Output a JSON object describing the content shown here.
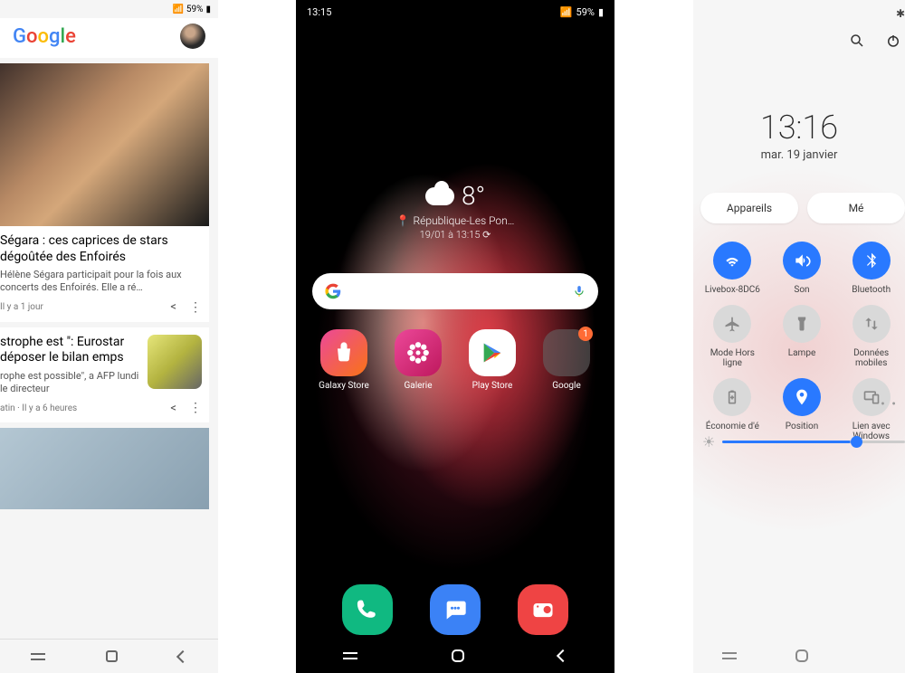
{
  "discover": {
    "status": {
      "battery": "59%"
    },
    "logo": [
      "G",
      "o",
      "o",
      "g",
      "l",
      "e"
    ],
    "card1": {
      "title": "Ségara : ces caprices de stars dégoûtée des Enfoirés",
      "body": "Hélène Ségara participait pour la fois aux concerts des Enfoirés. Elle a ré…",
      "meta": "Il y a 1 jour"
    },
    "card2": {
      "title": "strophe est \": Eurostar déposer le bilan emps",
      "body": "rophe est possible\", a AFP lundi le directeur",
      "meta": "atin  ·  Il y a 6 heures"
    }
  },
  "home": {
    "status": {
      "time": "13:15",
      "battery": "59%"
    },
    "weather": {
      "temp": "8°",
      "location": "République-Les Pon…",
      "date": "19/01 à 13:15 ⟳"
    },
    "apps": [
      {
        "label": "Galaxy Store"
      },
      {
        "label": "Galerie"
      },
      {
        "label": "Play Store"
      },
      {
        "label": "Google",
        "badge": "1"
      }
    ]
  },
  "qs": {
    "clock": {
      "time": "13:16",
      "date": "mar. 19 janvier"
    },
    "pills": [
      "Appareils",
      "Mé"
    ],
    "tiles": [
      {
        "label": "Livebox-8DC6",
        "glyph": "wifi",
        "on": true
      },
      {
        "label": "Son",
        "glyph": "sound",
        "on": true
      },
      {
        "label": "Bluetooth",
        "glyph": "bt",
        "on": true
      },
      {
        "label": "Mode Hors ligne",
        "glyph": "plane",
        "on": false
      },
      {
        "label": "Lampe",
        "glyph": "torch",
        "on": false
      },
      {
        "label": "Données mobiles",
        "glyph": "data",
        "on": false
      },
      {
        "label": "Économie d'é",
        "glyph": "battery",
        "on": false
      },
      {
        "label": "Position",
        "glyph": "pin",
        "on": true
      },
      {
        "label": "Lien avec Windows",
        "glyph": "link",
        "on": false
      }
    ]
  }
}
